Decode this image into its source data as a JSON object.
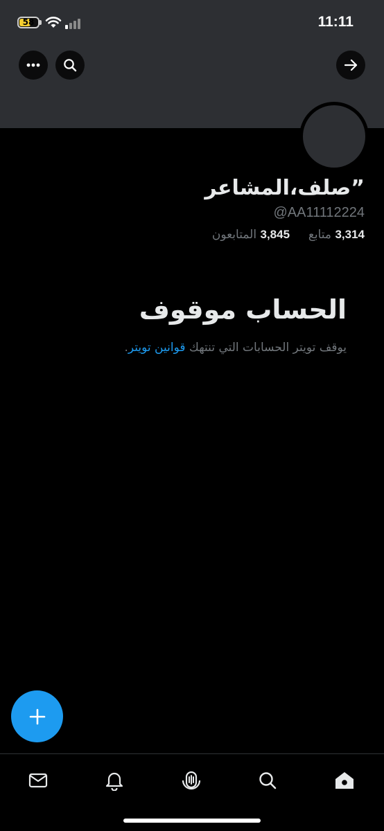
{
  "status_bar": {
    "time": "11:11",
    "battery_level": "58",
    "battery_color": "#f5cf30"
  },
  "header": {
    "more_icon": "more-horizontal-icon",
    "search_icon": "search-icon",
    "forward_icon": "arrow-right-icon"
  },
  "profile": {
    "display_name": "”صلف،المشاعر",
    "handle": "@AA11112224",
    "following_count": "3,314",
    "following_label": "متابع",
    "followers_count": "3,845",
    "followers_label": "المتابعون"
  },
  "suspended": {
    "title": "الحساب موقوف",
    "description": "يوقف تويتر الحسابات التي تنتهك",
    "rules_link": "قوانين تويتر",
    "period": "."
  },
  "fab": {
    "icon": "plus-icon",
    "color": "#1d9bf0"
  },
  "bottom_nav": {
    "items": [
      {
        "icon": "mail-icon"
      },
      {
        "icon": "bell-icon"
      },
      {
        "icon": "spaces-icon"
      },
      {
        "icon": "search-icon"
      },
      {
        "icon": "home-icon",
        "active": true
      }
    ]
  },
  "colors": {
    "background": "#000000",
    "banner": "#2d2f33",
    "primary_text": "#e7e9ea",
    "secondary_text": "#71767b",
    "accent": "#1d9bf0"
  }
}
